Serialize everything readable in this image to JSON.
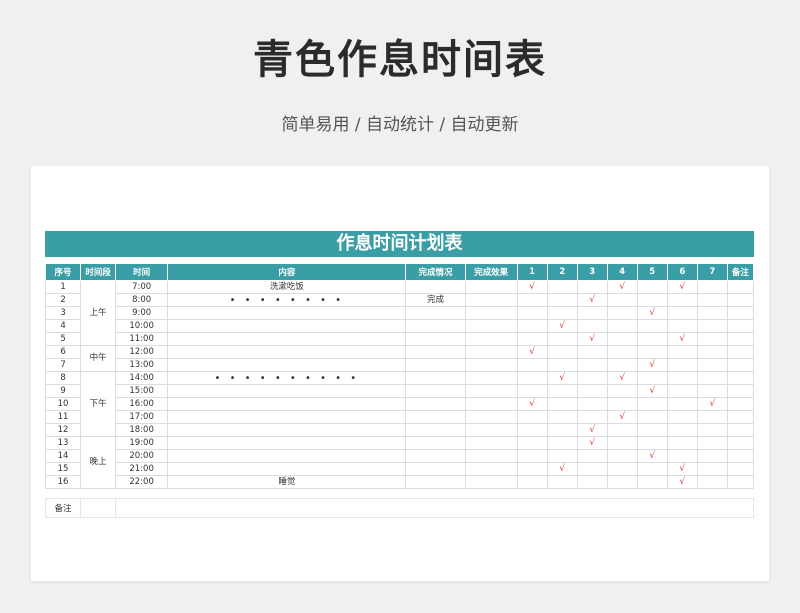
{
  "page": {
    "title": "青色作息时间表",
    "subtitle": "简单易用 / 自动统计 / 自动更新"
  },
  "sheet": {
    "banner": "作息时间计划表",
    "columns": [
      "序号",
      "时间段",
      "时间",
      "内容",
      "完成情况",
      "完成效果",
      "1",
      "2",
      "3",
      "4",
      "5",
      "6",
      "7",
      "备注"
    ],
    "periods": [
      {
        "label": "上午",
        "rows": 5
      },
      {
        "label": "中午",
        "rows": 2
      },
      {
        "label": "下午",
        "rows": 5
      },
      {
        "label": "晚上",
        "rows": 4
      }
    ],
    "rows": [
      {
        "no": "1",
        "time": "7:00",
        "content": "洗漱吃饭",
        "status": "",
        "checks": [
          1,
          4,
          6
        ]
      },
      {
        "no": "2",
        "time": "8:00",
        "content": "• • • • • • • •",
        "status": "完成",
        "checks": [
          3
        ]
      },
      {
        "no": "3",
        "time": "9:00",
        "content": "",
        "status": "",
        "checks": [
          5
        ]
      },
      {
        "no": "4",
        "time": "10:00",
        "content": "",
        "status": "",
        "checks": [
          2
        ]
      },
      {
        "no": "5",
        "time": "11:00",
        "content": "",
        "status": "",
        "checks": [
          3,
          6
        ]
      },
      {
        "no": "6",
        "time": "12:00",
        "content": "",
        "status": "",
        "checks": [
          1
        ]
      },
      {
        "no": "7",
        "time": "13:00",
        "content": "",
        "status": "",
        "checks": [
          5
        ]
      },
      {
        "no": "8",
        "time": "14:00",
        "content": "• • • • • • • • • •",
        "status": "",
        "checks": [
          2,
          4
        ]
      },
      {
        "no": "9",
        "time": "15:00",
        "content": "",
        "status": "",
        "checks": [
          5
        ]
      },
      {
        "no": "10",
        "time": "16:00",
        "content": "",
        "status": "",
        "checks": [
          1,
          7
        ]
      },
      {
        "no": "11",
        "time": "17:00",
        "content": "",
        "status": "",
        "checks": [
          4
        ]
      },
      {
        "no": "12",
        "time": "18:00",
        "content": "",
        "status": "",
        "checks": [
          3
        ]
      },
      {
        "no": "13",
        "time": "19:00",
        "content": "",
        "status": "",
        "checks": [
          3
        ]
      },
      {
        "no": "14",
        "time": "20:00",
        "content": "",
        "status": "",
        "checks": [
          5
        ]
      },
      {
        "no": "15",
        "time": "21:00",
        "content": "",
        "status": "",
        "checks": [
          2,
          6
        ]
      },
      {
        "no": "16",
        "time": "22:00",
        "content": "睡觉",
        "status": "",
        "checks": [
          6
        ]
      }
    ],
    "check_mark": "√",
    "notes_label": "备注"
  },
  "colors": {
    "accent": "#3a9ea6",
    "check": "#e03434",
    "background": "#eef0f1"
  }
}
